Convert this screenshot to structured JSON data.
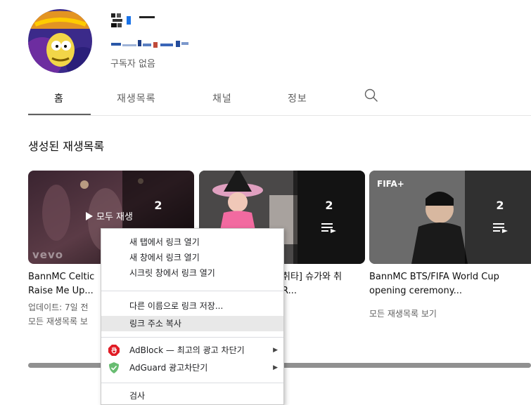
{
  "channel": {
    "subscribers": "구독자 없음"
  },
  "tabs": [
    {
      "label": "홈"
    },
    {
      "label": "재생목록"
    },
    {
      "label": "채널"
    },
    {
      "label": "정보"
    }
  ],
  "section": {
    "title": "생성된 재생목록"
  },
  "playlists": [
    {
      "overlay_count": "2",
      "play_all": "모두 재생",
      "watermark": "vevo",
      "title_line1": "BannMC Celtic",
      "title_line2": "Raise Me Up...",
      "meta": "업데이트: 7일 전",
      "link": "모든 재생목록 보"
    },
    {
      "overlay_count": "2",
      "title_line1": "취타] 슈가와 취",
      "title_line2": "R..."
    },
    {
      "overlay_count": "2",
      "brand": "FIFA+",
      "title_line1": "BannMC BTS/FIFA World Cup",
      "title_line2": "opening ceremony...",
      "link": "모든 재생목록 보기"
    }
  ],
  "context_menu": {
    "items": [
      {
        "label": "새 탭에서 링크 열기"
      },
      {
        "label": "새 창에서 링크 열기"
      },
      {
        "label": "시크릿 창에서 링크 열기"
      },
      {
        "label": "다른 이름으로 링크 저장..."
      },
      {
        "label": "링크 주소 복사"
      },
      {
        "label": "AdBlock — 최고의 광고 차단기",
        "icon": "adblock-icon"
      },
      {
        "label": "AdGuard 광고차단기",
        "icon": "adguard-icon"
      },
      {
        "label": "검사"
      }
    ]
  },
  "colors": {
    "text_secondary": "#606060",
    "menu_highlight": "#e8e8e8",
    "adblock_red": "#e11c25",
    "adguard_green": "#68bc71"
  }
}
